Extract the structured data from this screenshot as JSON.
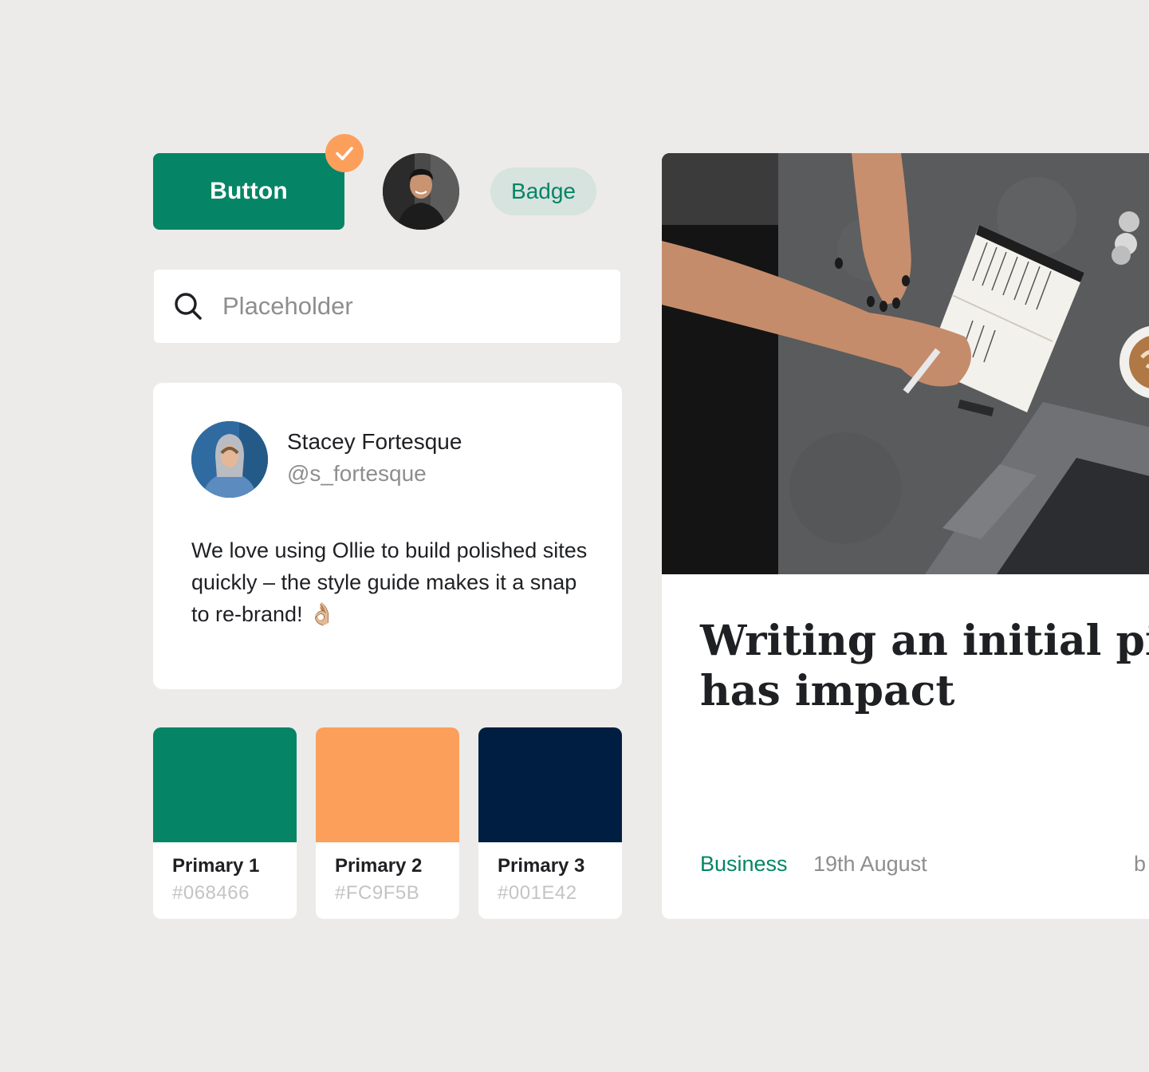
{
  "button": {
    "label": "Button",
    "color": "#068466"
  },
  "status_badge": {
    "icon": "checkmark-icon",
    "color": "#FC9F5B"
  },
  "badge": {
    "label": "Badge"
  },
  "search": {
    "placeholder": "Placeholder",
    "value": "",
    "icon": "search-icon"
  },
  "testimonial": {
    "name": "Stacey Fortesque",
    "handle": "@s_fortesque",
    "quote": "We love using Ollie to build polished sites quickly – the style guide makes it a snap to re-brand! 👌🏼"
  },
  "swatches": [
    {
      "name": "Primary 1",
      "hex": "#068466"
    },
    {
      "name": "Primary 2",
      "hex": "#FC9F5B"
    },
    {
      "name": "Primary 3",
      "hex": "#001E42"
    }
  ],
  "article": {
    "title_line1": "Writing an initial pitch",
    "title_line2": "has impact",
    "category": "Business",
    "date": "19th August",
    "byline": "b"
  }
}
